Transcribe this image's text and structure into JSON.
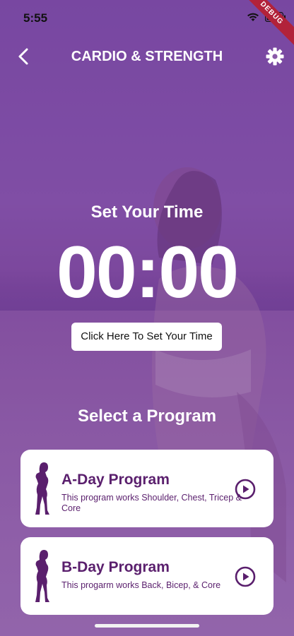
{
  "status_bar": {
    "time": "5:55",
    "debug_label": "DEBUG"
  },
  "app_bar": {
    "title": "CARDIO & STRENGTH",
    "back_icon": "chevron-left-icon",
    "settings_icon": "gear-icon"
  },
  "timer": {
    "heading": "Set Your Time",
    "display": "00:00",
    "set_button_label": "Click Here To Set Your Time"
  },
  "programs": {
    "heading": "Select a Program",
    "items": [
      {
        "title": "A-Day Program",
        "description": "This program works Shoulder, Chest, Tricep & Core",
        "icon": "silhouette-icon",
        "action_icon": "play-circle-icon"
      },
      {
        "title": "B-Day Program",
        "description": "This progarm works Back, Bicep, & Core",
        "icon": "silhouette-icon",
        "action_icon": "play-circle-icon"
      }
    ]
  },
  "colors": {
    "accent": "#5a1f6d",
    "overlay": "#7d4d98",
    "card_background": "#ffffff"
  }
}
